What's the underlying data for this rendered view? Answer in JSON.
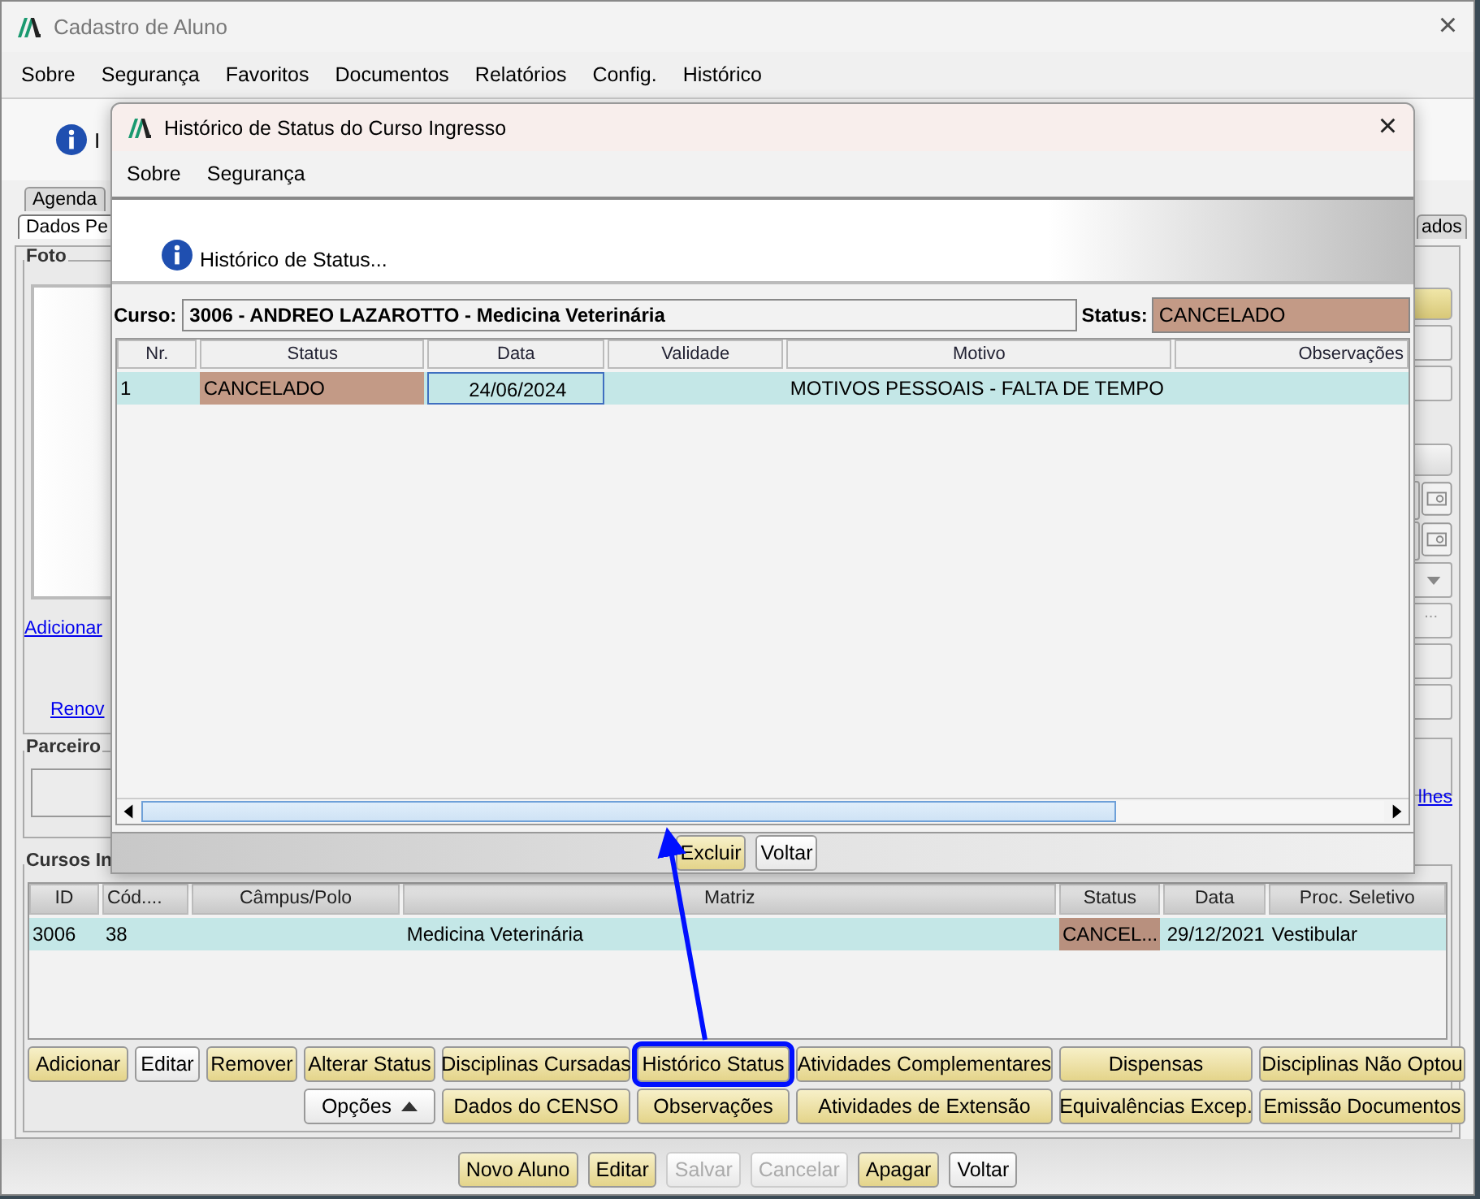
{
  "window": {
    "title": "Cadastro de Aluno",
    "close": "×"
  },
  "menu": [
    "Sobre",
    "Segurança",
    "Favoritos",
    "Documentos",
    "Relatórios",
    "Config.",
    "Histórico"
  ],
  "header": {
    "text": "I"
  },
  "tabs": [
    {
      "label": "Agenda",
      "selected": false,
      "kind": "back"
    },
    {
      "label": "Dados Pe",
      "selected": true,
      "kind": "front"
    },
    {
      "label": "ados",
      "selected": false,
      "kind": "right"
    }
  ],
  "foto": {
    "title": "Foto",
    "links": [
      "Adicionar",
      "Renov"
    ]
  },
  "parceiro": {
    "title": "Parceiro"
  },
  "side_controls": [
    {
      "kind": "button"
    },
    {
      "kind": "field"
    },
    {
      "kind": "field"
    },
    {
      "kind": "gap"
    },
    {
      "kind": "plain_button"
    },
    {
      "kind": "camera"
    },
    {
      "kind": "camera"
    },
    {
      "kind": "dropdown"
    },
    {
      "kind": "ellipsis",
      "label": "..."
    },
    {
      "kind": "field"
    },
    {
      "kind": "field"
    },
    {
      "kind": "box"
    }
  ],
  "side_link": "lhes",
  "cursos": {
    "title": "Cursos In",
    "columns": [
      "ID",
      "Cód....",
      "Câmpus/Polo",
      "Matriz",
      "Status",
      "Data",
      "Proc. Seletivo"
    ],
    "rows": [
      {
        "cells": [
          "3006",
          "38",
          "",
          "Medicina Veterinária",
          "CANCEL...",
          "29/12/2021",
          "Vestibular"
        ],
        "color": "#b8907e"
      }
    ]
  },
  "actions": [
    {
      "label": "Adicionar",
      "kind": "gold",
      "annotated": false
    },
    {
      "label": "Editar",
      "kind": "plain",
      "annotated": false
    },
    {
      "label": "Remover",
      "kind": "gold",
      "annotated": false
    },
    {
      "label": "Alterar Status",
      "kind": "gold",
      "annotated": false
    },
    {
      "label": "Disciplinas Cursadas",
      "kind": "gold",
      "annotated": false
    },
    {
      "label": "Histórico Status",
      "kind": "gold",
      "annotated": true
    },
    {
      "label": "Atividades Complementares",
      "kind": "gold",
      "annotated": false
    },
    {
      "label": "Dispensas",
      "kind": "gold",
      "annotated": false
    },
    {
      "label": "Disciplinas Não Optou",
      "kind": "gold",
      "annotated": false
    },
    {
      "label": "Opções",
      "kind": "menu",
      "annotated": false
    },
    {
      "label": "Dados do CENSO",
      "kind": "gold",
      "annotated": false
    },
    {
      "label": "Observações",
      "kind": "gold",
      "annotated": false
    },
    {
      "label": "Atividades de Extensão",
      "kind": "gold",
      "annotated": false
    },
    {
      "label": "Equivalências Excep.",
      "kind": "gold",
      "annotated": false
    },
    {
      "label": "Emissão Documentos",
      "kind": "gold",
      "annotated": false
    }
  ],
  "bottom_buttons": [
    {
      "label": "Novo Aluno",
      "kind": "gold",
      "disabled": false
    },
    {
      "label": "Editar",
      "kind": "gold",
      "disabled": false
    },
    {
      "label": "Salvar",
      "kind": "plain",
      "disabled": true
    },
    {
      "label": "Cancelar",
      "kind": "plain",
      "disabled": true
    },
    {
      "label": "Apagar",
      "kind": "gold",
      "disabled": false
    },
    {
      "label": "Voltar",
      "kind": "plain",
      "disabled": false
    }
  ],
  "dialog": {
    "title": "Histórico de Status do Curso Ingresso",
    "close": "×",
    "menu": [
      "Sobre",
      "Segurança"
    ],
    "banner": "Histórico de Status...",
    "curso_label": "Curso:",
    "curso": "3006 - ANDREO LAZAROTTO - Medicina Veterinária",
    "status_label": "Status:",
    "status": {
      "text": "CANCELADO",
      "color": "#c39a86"
    },
    "columns": [
      "Nr.",
      "Status",
      "Data",
      "Validade",
      "Motivo",
      "Observações"
    ],
    "rows": [
      {
        "cells": [
          {
            "text": "1",
            "focused": false
          },
          {
            "text": "CANCELADO",
            "focused": false,
            "color": "#c39a86"
          },
          {
            "text": "24/06/2024",
            "focused": true
          },
          {},
          {
            "text": "MOTIVOS PESSOAIS - FALTA DE TEMPO",
            "focused": false
          },
          {}
        ]
      }
    ],
    "buttons": [
      {
        "label": "Excluir",
        "kind": "gold"
      },
      {
        "label": "Voltar",
        "kind": "plain"
      }
    ]
  }
}
